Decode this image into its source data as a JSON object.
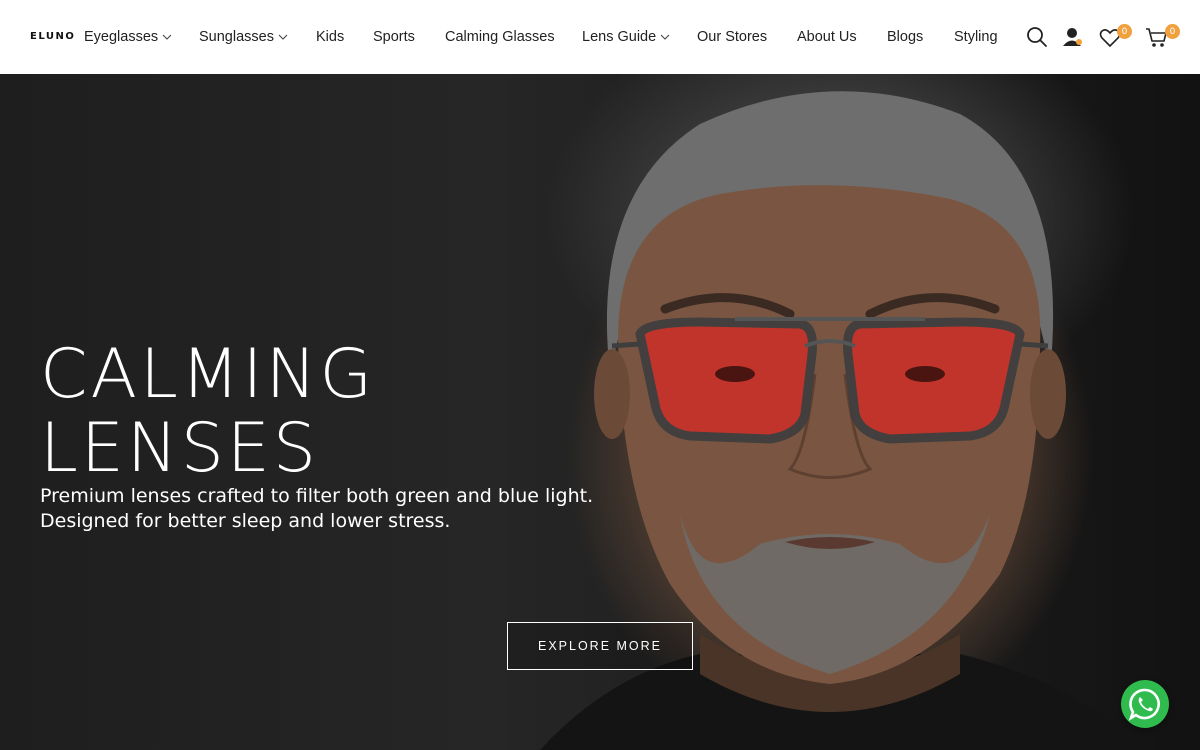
{
  "brand": {
    "logo_text": "ELUNO"
  },
  "nav": {
    "items": [
      {
        "label": "Eyeglasses",
        "has_dropdown": true
      },
      {
        "label": "Sunglasses",
        "has_dropdown": true
      },
      {
        "label": "Kids",
        "has_dropdown": false
      },
      {
        "label": "Sports",
        "has_dropdown": false
      },
      {
        "label": "Calming Glasses",
        "has_dropdown": false
      },
      {
        "label": "Lens Guide",
        "has_dropdown": true
      },
      {
        "label": "Our Stores",
        "has_dropdown": false
      },
      {
        "label": "About Us",
        "has_dropdown": false
      },
      {
        "label": "Blogs",
        "has_dropdown": false
      },
      {
        "label": "Styling",
        "has_dropdown": false
      }
    ]
  },
  "header_icons": {
    "search": "search-icon",
    "account": "user-icon",
    "wishlist": {
      "icon": "heart-icon",
      "count": "0"
    },
    "cart": {
      "icon": "cart-icon",
      "count": "0"
    }
  },
  "hero": {
    "title_line1": "CALMING",
    "title_line2": "LENSES",
    "subtitle_line1": "Premium lenses crafted to filter both green and blue light.",
    "subtitle_line2": "Designed for better sleep and lower stress.",
    "cta_label": "EXPLORE MORE",
    "image": "man-wearing-red-tinted-aviator-glasses"
  },
  "floating": {
    "whatsapp": "whatsapp-icon"
  },
  "colors": {
    "badge": "#f0a03c",
    "whatsapp": "#2fbb4e",
    "lens_red": "#c8322a"
  }
}
